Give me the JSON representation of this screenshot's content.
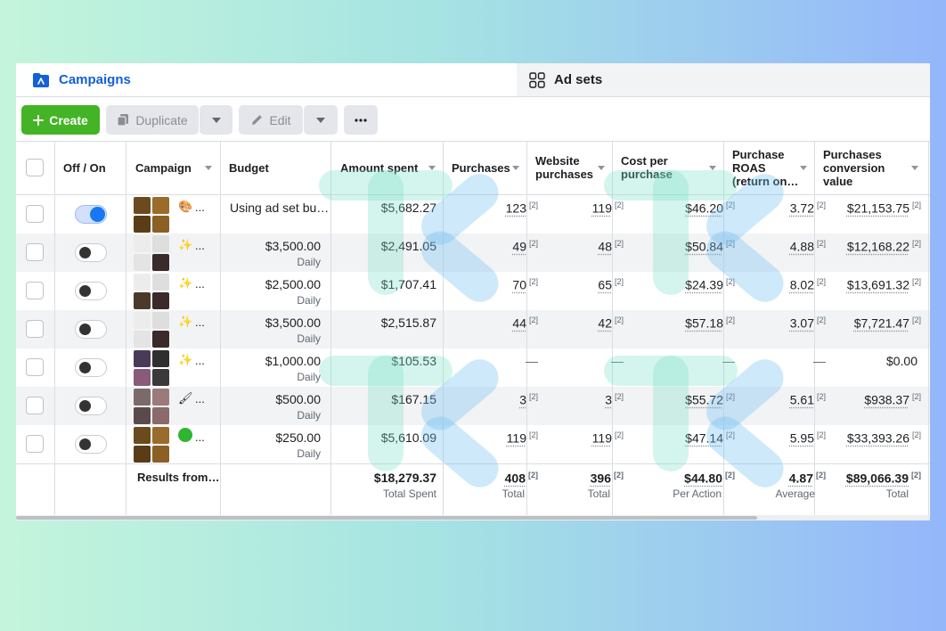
{
  "tabs": {
    "campaigns": "Campaigns",
    "ad_sets": "Ad sets"
  },
  "toolbar": {
    "create": "Create",
    "duplicate": "Duplicate",
    "edit": "Edit"
  },
  "columns": {
    "off_on": "Off / On",
    "campaign": "Campaign",
    "budget": "Budget",
    "amount_spent": "Amount spent",
    "purchases": "Purchases",
    "website_purchases_1": "Website",
    "website_purchases_2": "purchases",
    "cost_per_purchase_1": "Cost per",
    "cost_per_purchase_2": "purchase",
    "roas_1": "Purchase",
    "roas_2": "ROAS",
    "roas_3": "(return on…",
    "conv_value_1": "Purchases",
    "conv_value_2": "conversion",
    "conv_value_3": "value"
  },
  "rows": [
    {
      "on": true,
      "ellipsis": "...",
      "budget": "Using ad set bu…",
      "budget_sub": "",
      "spent": "$5,682.27",
      "purchases": "123",
      "website_purchases": "119",
      "cost_per": "$46.20",
      "roas": "3.72",
      "value": "$21,153.75"
    },
    {
      "on": false,
      "ellipsis": "...",
      "budget": "$3,500.00",
      "budget_sub": "Daily",
      "spent": "$2,491.05",
      "purchases": "49",
      "website_purchases": "48",
      "cost_per": "$50.84",
      "roas": "4.88",
      "value": "$12,168.22"
    },
    {
      "on": false,
      "ellipsis": "...",
      "budget": "$2,500.00",
      "budget_sub": "Daily",
      "spent": "$1,707.41",
      "purchases": "70",
      "website_purchases": "65",
      "cost_per": "$24.39",
      "roas": "8.02",
      "value": "$13,691.32"
    },
    {
      "on": false,
      "ellipsis": "...",
      "budget": "$3,500.00",
      "budget_sub": "Daily",
      "spent": "$2,515.87",
      "purchases": "44",
      "website_purchases": "42",
      "cost_per": "$57.18",
      "roas": "3.07",
      "value": "$7,721.47"
    },
    {
      "on": false,
      "ellipsis": "...",
      "budget": "$1,000.00",
      "budget_sub": "Daily",
      "spent": "$105.53",
      "purchases": "—",
      "website_purchases": "—",
      "cost_per": "—",
      "roas": "—",
      "value": "$0.00"
    },
    {
      "on": false,
      "ellipsis": "...",
      "budget": "$500.00",
      "budget_sub": "Daily",
      "spent": "$167.15",
      "purchases": "3",
      "website_purchases": "3",
      "cost_per": "$55.72",
      "roas": "5.61",
      "value": "$938.37"
    },
    {
      "on": false,
      "ellipsis": "...",
      "budget": "$250.00",
      "budget_sub": "Daily",
      "spent": "$5,610.09",
      "purchases": "119",
      "website_purchases": "119",
      "cost_per": "$47.14",
      "roas": "5.95",
      "value": "$33,393.26"
    }
  ],
  "attribution_marker": "[2]",
  "totals": {
    "label": "Results from…",
    "spent": "$18,279.37",
    "spent_sub": "Total Spent",
    "purchases": "408",
    "purchases_sub": "Total",
    "website_purchases": "396",
    "website_purchases_sub": "Total",
    "cost_per": "$44.80",
    "cost_per_sub": "Per Action",
    "roas": "4.87",
    "roas_sub": "Average",
    "value": "$89,066.39",
    "value_sub": "Total"
  },
  "colors": {
    "brand_blue": "#1360d8",
    "create_green": "#43b425",
    "toggle_on": "#1877f2"
  },
  "icons": [
    "folder-icon",
    "ad-sets-grid-icon",
    "plus-icon",
    "duplicate-icon",
    "pencil-icon",
    "more-dots-icon",
    "sort-caret-icon"
  ]
}
